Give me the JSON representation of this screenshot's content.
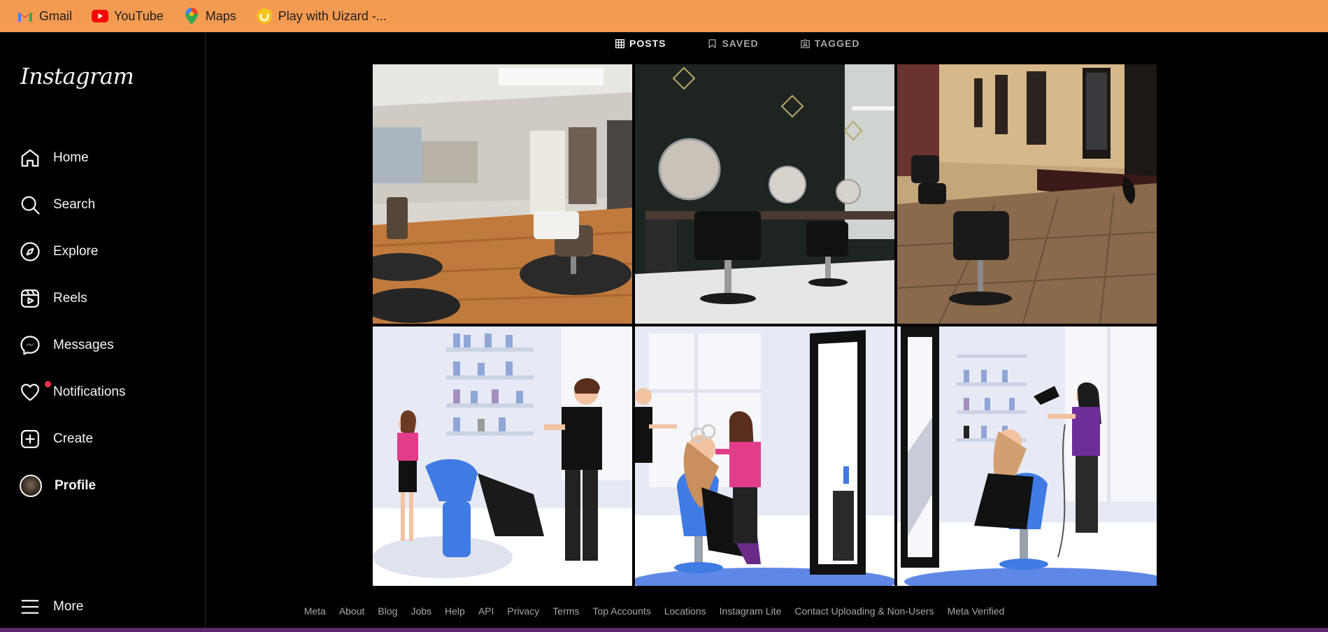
{
  "bookmarks": [
    {
      "label": "Gmail",
      "icon": "gmail-icon"
    },
    {
      "label": "YouTube",
      "icon": "youtube-icon"
    },
    {
      "label": "Maps",
      "icon": "maps-icon"
    },
    {
      "label": "Play with Uizard -...",
      "icon": "uizard-icon"
    }
  ],
  "sidebar": {
    "logo": "Instagram",
    "items": [
      {
        "label": "Home",
        "icon": "home-icon"
      },
      {
        "label": "Search",
        "icon": "search-icon"
      },
      {
        "label": "Explore",
        "icon": "compass-icon"
      },
      {
        "label": "Reels",
        "icon": "reels-icon"
      },
      {
        "label": "Messages",
        "icon": "messenger-icon"
      },
      {
        "label": "Notifications",
        "icon": "heart-icon"
      },
      {
        "label": "Create",
        "icon": "plus-square-icon"
      },
      {
        "label": "Profile",
        "icon": "avatar"
      },
      {
        "label": "More",
        "icon": "hamburger-icon"
      }
    ]
  },
  "profile_tabs": [
    {
      "label": "POSTS",
      "icon": "grid-icon",
      "active": true
    },
    {
      "label": "SAVED",
      "icon": "bookmark-icon",
      "active": false
    },
    {
      "label": "TAGGED",
      "icon": "tag-icon",
      "active": false
    }
  ],
  "posts_count_shown": 6,
  "footer": {
    "links": [
      "Meta",
      "About",
      "Blog",
      "Jobs",
      "Help",
      "API",
      "Privacy",
      "Terms",
      "Top Accounts",
      "Locations",
      "Instagram Lite",
      "Contact Uploading & Non-Users",
      "Meta Verified"
    ]
  },
  "colors": {
    "bookmarks_bar": "#f49b52",
    "background": "#000000",
    "notification_dot": "#ff3040"
  }
}
